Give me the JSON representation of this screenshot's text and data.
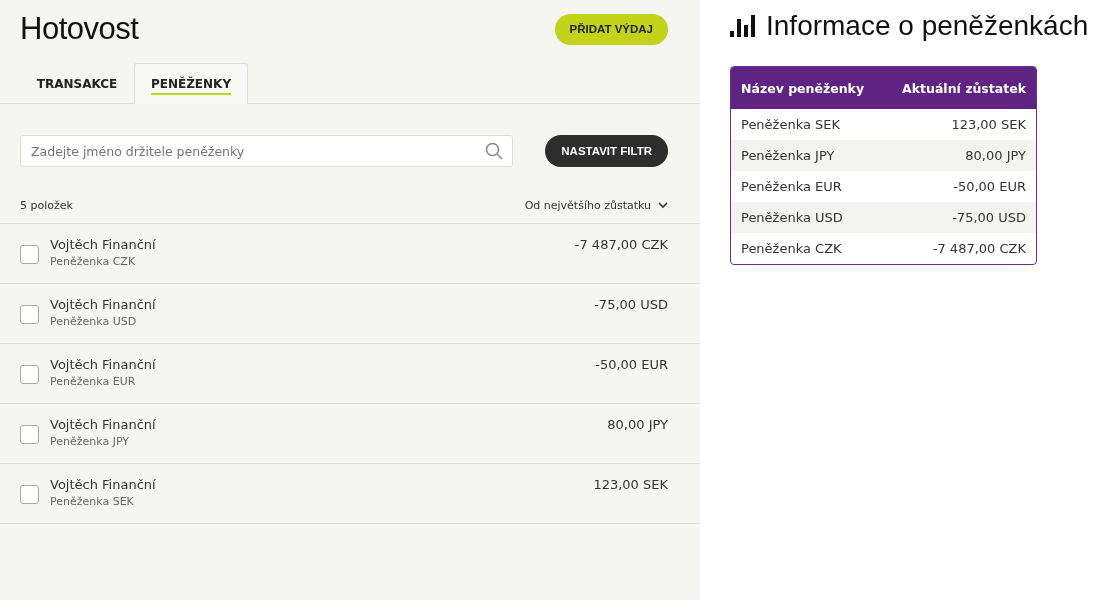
{
  "page": {
    "title": "Hotovost",
    "add_button": "PŘIDAT VÝDAJ"
  },
  "tabs": [
    {
      "label": "TRANSAKCE",
      "selected": false
    },
    {
      "label": "PENĚŽENKY",
      "selected": true
    }
  ],
  "search": {
    "placeholder": "Zadejte jméno držitele peněženky"
  },
  "filter_button": "NASTAVIT FILTR",
  "count": "5 položek",
  "sort": "Od největšího zůstatku",
  "wallets": [
    {
      "holder": "Vojtěch Finanční",
      "wallet": "Peněženka CZK",
      "balance": "-7 487,00 CZK",
      "checked": false
    },
    {
      "holder": "Vojtěch Finanční",
      "wallet": "Peněženka USD",
      "balance": "-75,00 USD",
      "checked": false
    },
    {
      "holder": "Vojtěch Finanční",
      "wallet": "Peněženka EUR",
      "balance": "-50,00 EUR",
      "checked": false
    },
    {
      "holder": "Vojtěch Finanční",
      "wallet": "Peněženka JPY",
      "balance": "80,00 JPY",
      "checked": false
    },
    {
      "holder": "Vojtěch Finanční",
      "wallet": "Peněženka SEK",
      "balance": "123,00 SEK",
      "checked": false
    }
  ],
  "info": {
    "title": "Informace o peněženkách",
    "columns": [
      "Název peněženky",
      "Aktuální zůstatek"
    ],
    "rows": [
      [
        "Peněženka SEK",
        "123,00 SEK"
      ],
      [
        "Peněženka JPY",
        "80,00 JPY"
      ],
      [
        "Peněženka EUR",
        "-50,00 EUR"
      ],
      [
        "Peněženka USD",
        "-75,00 USD"
      ],
      [
        "Peněženka CZK",
        "-7 487,00 CZK"
      ]
    ]
  }
}
